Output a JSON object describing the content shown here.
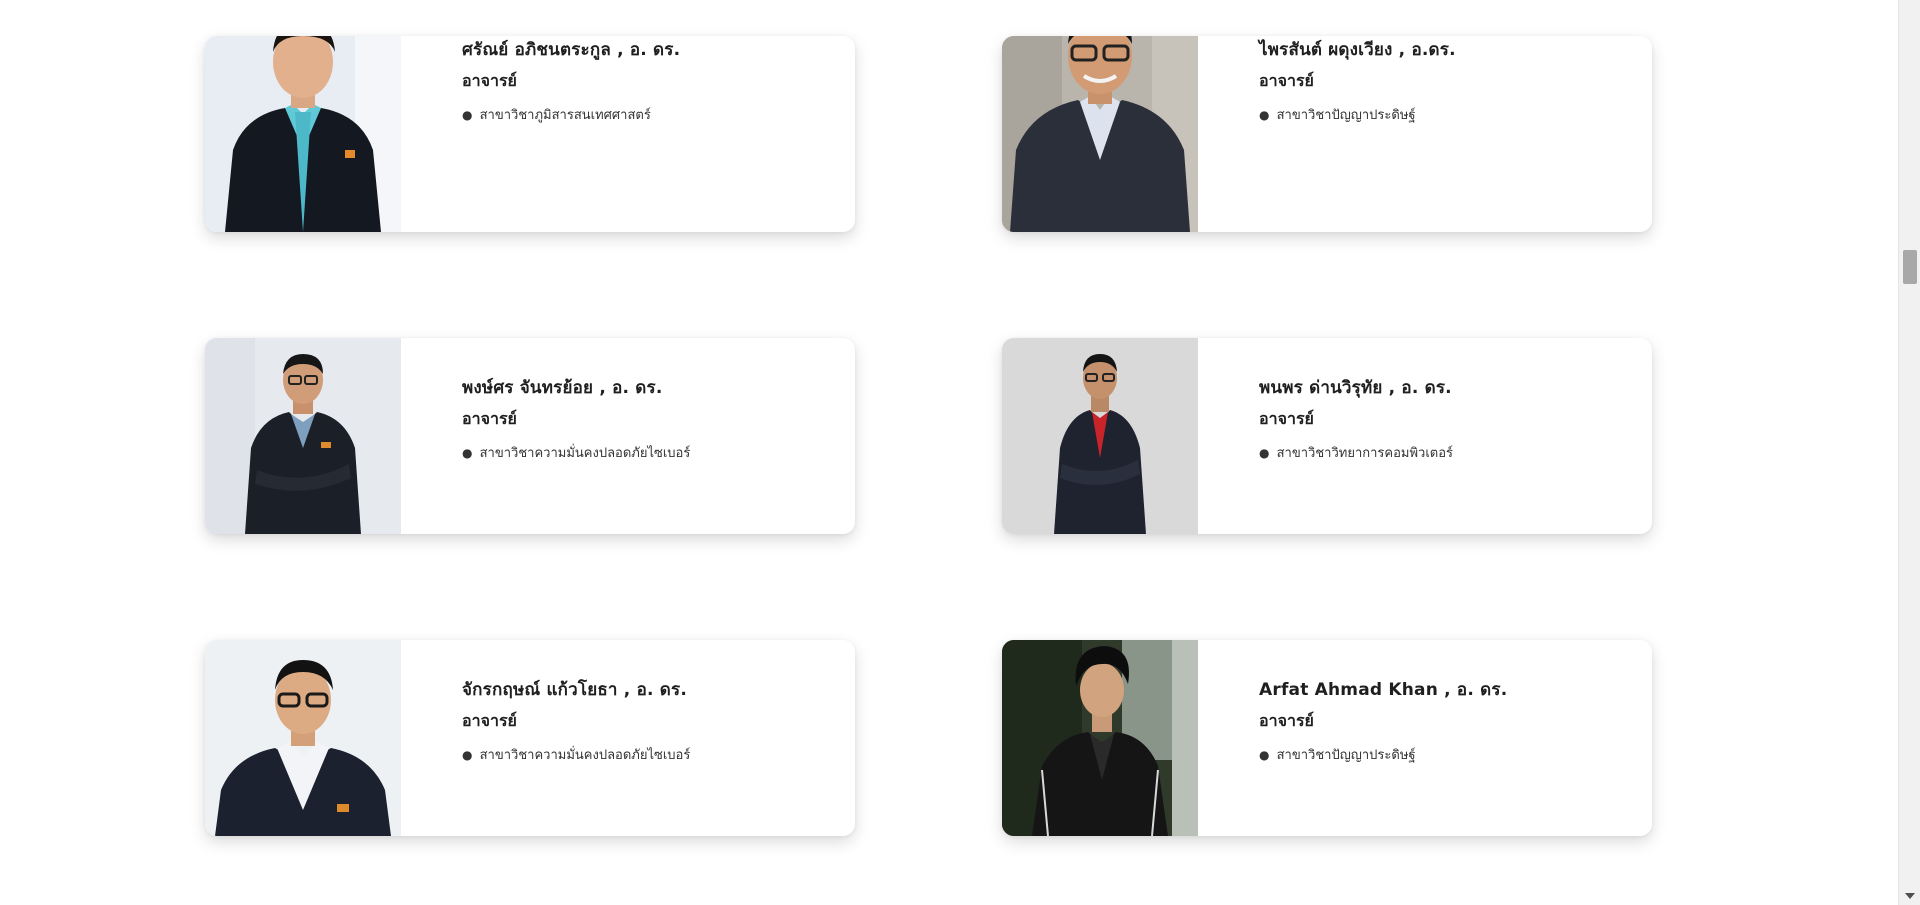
{
  "faculty": [
    {
      "name": "ศรัณย์ อภิชนตระกูล , อ. ดร.",
      "position": "อาจารย์",
      "department": "สาขาวิชาภูมิสารสนเทศศาสตร์",
      "photo_icon": "portrait-photo"
    },
    {
      "name": "ไพรสันต์ ผดุงเวียง , อ.ดร.",
      "position": "อาจารย์",
      "department": "สาขาวิชาปัญญาประดิษฐ์",
      "photo_icon": "portrait-photo"
    },
    {
      "name": "พงษ์ศร จันทรย้อย , อ. ดร.",
      "position": "อาจารย์",
      "department": "สาขาวิชาความมั่นคงปลอดภัยไซเบอร์",
      "photo_icon": "portrait-photo"
    },
    {
      "name": "พนพร ด่านวิรุทัย , อ. ดร.",
      "position": "อาจารย์",
      "department": "สาขาวิชาวิทยาการคอมพิวเตอร์",
      "photo_icon": "portrait-photo"
    },
    {
      "name": "จักรกฤษณ์ แก้วโยธา , อ. ดร.",
      "position": "อาจารย์",
      "department": "สาขาวิชาความมั่นคงปลอดภัยไซเบอร์",
      "photo_icon": "portrait-photo"
    },
    {
      "name": "Arfat Ahmad Khan , อ. ดร.",
      "position": "อาจารย์",
      "department": "สาขาวิชาปัญญาประดิษฐ์",
      "photo_icon": "portrait-photo"
    }
  ],
  "bullet": "●",
  "colors": {
    "card_bg": "#ffffff",
    "text": "#1f1f1f",
    "page_bg": "#ffffff"
  }
}
